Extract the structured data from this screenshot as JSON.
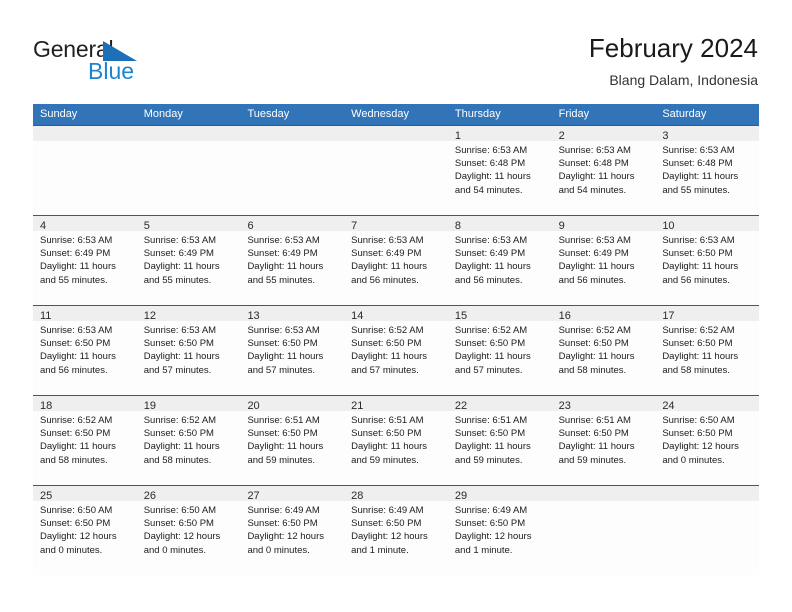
{
  "logo": {
    "primary_text": "General",
    "secondary_text": "Blue",
    "triangle_icon": "triangle-icon",
    "primary_color": "#231f20",
    "secondary_color": "#1d84d4"
  },
  "header": {
    "title": "February 2024",
    "subtitle": "Blang Dalam, Indonesia"
  },
  "theme": {
    "header_blue": "#3274b8",
    "row_rule_blue": "#1f5fa0",
    "date_band_gray": "#efefef",
    "cell_background": "#fdfdfd"
  },
  "weekday_headers": [
    "Sunday",
    "Monday",
    "Tuesday",
    "Wednesday",
    "Thursday",
    "Friday",
    "Saturday"
  ],
  "weeks": [
    [
      {
        "day": "",
        "empty": true
      },
      {
        "day": "",
        "empty": true
      },
      {
        "day": "",
        "empty": true
      },
      {
        "day": "",
        "empty": true
      },
      {
        "day": "1",
        "sunrise": "Sunrise: 6:53 AM",
        "sunset": "Sunset: 6:48 PM",
        "daylight_1": "Daylight: 11 hours",
        "daylight_2": "and 54 minutes."
      },
      {
        "day": "2",
        "sunrise": "Sunrise: 6:53 AM",
        "sunset": "Sunset: 6:48 PM",
        "daylight_1": "Daylight: 11 hours",
        "daylight_2": "and 54 minutes."
      },
      {
        "day": "3",
        "sunrise": "Sunrise: 6:53 AM",
        "sunset": "Sunset: 6:48 PM",
        "daylight_1": "Daylight: 11 hours",
        "daylight_2": "and 55 minutes."
      }
    ],
    [
      {
        "day": "4",
        "sunrise": "Sunrise: 6:53 AM",
        "sunset": "Sunset: 6:49 PM",
        "daylight_1": "Daylight: 11 hours",
        "daylight_2": "and 55 minutes."
      },
      {
        "day": "5",
        "sunrise": "Sunrise: 6:53 AM",
        "sunset": "Sunset: 6:49 PM",
        "daylight_1": "Daylight: 11 hours",
        "daylight_2": "and 55 minutes."
      },
      {
        "day": "6",
        "sunrise": "Sunrise: 6:53 AM",
        "sunset": "Sunset: 6:49 PM",
        "daylight_1": "Daylight: 11 hours",
        "daylight_2": "and 55 minutes."
      },
      {
        "day": "7",
        "sunrise": "Sunrise: 6:53 AM",
        "sunset": "Sunset: 6:49 PM",
        "daylight_1": "Daylight: 11 hours",
        "daylight_2": "and 56 minutes."
      },
      {
        "day": "8",
        "sunrise": "Sunrise: 6:53 AM",
        "sunset": "Sunset: 6:49 PM",
        "daylight_1": "Daylight: 11 hours",
        "daylight_2": "and 56 minutes."
      },
      {
        "day": "9",
        "sunrise": "Sunrise: 6:53 AM",
        "sunset": "Sunset: 6:49 PM",
        "daylight_1": "Daylight: 11 hours",
        "daylight_2": "and 56 minutes."
      },
      {
        "day": "10",
        "sunrise": "Sunrise: 6:53 AM",
        "sunset": "Sunset: 6:50 PM",
        "daylight_1": "Daylight: 11 hours",
        "daylight_2": "and 56 minutes."
      }
    ],
    [
      {
        "day": "11",
        "sunrise": "Sunrise: 6:53 AM",
        "sunset": "Sunset: 6:50 PM",
        "daylight_1": "Daylight: 11 hours",
        "daylight_2": "and 56 minutes."
      },
      {
        "day": "12",
        "sunrise": "Sunrise: 6:53 AM",
        "sunset": "Sunset: 6:50 PM",
        "daylight_1": "Daylight: 11 hours",
        "daylight_2": "and 57 minutes."
      },
      {
        "day": "13",
        "sunrise": "Sunrise: 6:53 AM",
        "sunset": "Sunset: 6:50 PM",
        "daylight_1": "Daylight: 11 hours",
        "daylight_2": "and 57 minutes."
      },
      {
        "day": "14",
        "sunrise": "Sunrise: 6:52 AM",
        "sunset": "Sunset: 6:50 PM",
        "daylight_1": "Daylight: 11 hours",
        "daylight_2": "and 57 minutes."
      },
      {
        "day": "15",
        "sunrise": "Sunrise: 6:52 AM",
        "sunset": "Sunset: 6:50 PM",
        "daylight_1": "Daylight: 11 hours",
        "daylight_2": "and 57 minutes."
      },
      {
        "day": "16",
        "sunrise": "Sunrise: 6:52 AM",
        "sunset": "Sunset: 6:50 PM",
        "daylight_1": "Daylight: 11 hours",
        "daylight_2": "and 58 minutes."
      },
      {
        "day": "17",
        "sunrise": "Sunrise: 6:52 AM",
        "sunset": "Sunset: 6:50 PM",
        "daylight_1": "Daylight: 11 hours",
        "daylight_2": "and 58 minutes."
      }
    ],
    [
      {
        "day": "18",
        "sunrise": "Sunrise: 6:52 AM",
        "sunset": "Sunset: 6:50 PM",
        "daylight_1": "Daylight: 11 hours",
        "daylight_2": "and 58 minutes."
      },
      {
        "day": "19",
        "sunrise": "Sunrise: 6:52 AM",
        "sunset": "Sunset: 6:50 PM",
        "daylight_1": "Daylight: 11 hours",
        "daylight_2": "and 58 minutes."
      },
      {
        "day": "20",
        "sunrise": "Sunrise: 6:51 AM",
        "sunset": "Sunset: 6:50 PM",
        "daylight_1": "Daylight: 11 hours",
        "daylight_2": "and 59 minutes."
      },
      {
        "day": "21",
        "sunrise": "Sunrise: 6:51 AM",
        "sunset": "Sunset: 6:50 PM",
        "daylight_1": "Daylight: 11 hours",
        "daylight_2": "and 59 minutes."
      },
      {
        "day": "22",
        "sunrise": "Sunrise: 6:51 AM",
        "sunset": "Sunset: 6:50 PM",
        "daylight_1": "Daylight: 11 hours",
        "daylight_2": "and 59 minutes."
      },
      {
        "day": "23",
        "sunrise": "Sunrise: 6:51 AM",
        "sunset": "Sunset: 6:50 PM",
        "daylight_1": "Daylight: 11 hours",
        "daylight_2": "and 59 minutes."
      },
      {
        "day": "24",
        "sunrise": "Sunrise: 6:50 AM",
        "sunset": "Sunset: 6:50 PM",
        "daylight_1": "Daylight: 12 hours",
        "daylight_2": "and 0 minutes."
      }
    ],
    [
      {
        "day": "25",
        "sunrise": "Sunrise: 6:50 AM",
        "sunset": "Sunset: 6:50 PM",
        "daylight_1": "Daylight: 12 hours",
        "daylight_2": "and 0 minutes."
      },
      {
        "day": "26",
        "sunrise": "Sunrise: 6:50 AM",
        "sunset": "Sunset: 6:50 PM",
        "daylight_1": "Daylight: 12 hours",
        "daylight_2": "and 0 minutes."
      },
      {
        "day": "27",
        "sunrise": "Sunrise: 6:49 AM",
        "sunset": "Sunset: 6:50 PM",
        "daylight_1": "Daylight: 12 hours",
        "daylight_2": "and 0 minutes."
      },
      {
        "day": "28",
        "sunrise": "Sunrise: 6:49 AM",
        "sunset": "Sunset: 6:50 PM",
        "daylight_1": "Daylight: 12 hours",
        "daylight_2": "and 1 minute."
      },
      {
        "day": "29",
        "sunrise": "Sunrise: 6:49 AM",
        "sunset": "Sunset: 6:50 PM",
        "daylight_1": "Daylight: 12 hours",
        "daylight_2": "and 1 minute."
      },
      {
        "day": "",
        "empty": true
      },
      {
        "day": "",
        "empty": true
      }
    ]
  ]
}
